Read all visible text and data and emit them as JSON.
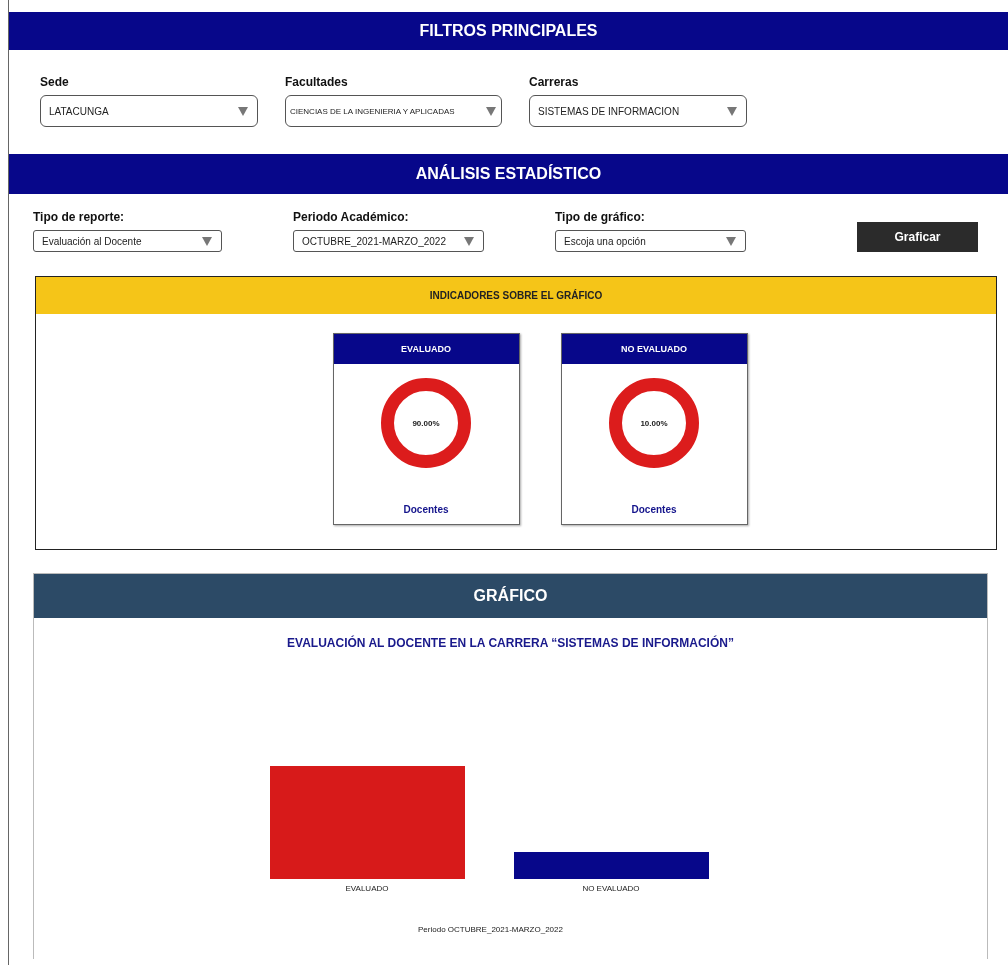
{
  "filters": {
    "title": "FILTROS PRINCIPALES",
    "selects": [
      {
        "label": "Sede",
        "value": "LATACUNGA"
      },
      {
        "label": "Facultades",
        "value": "CIENCIAS DE LA INGENIERIA Y APLICADAS"
      },
      {
        "label": "Carreras",
        "value": "SISTEMAS DE INFORMACION"
      }
    ]
  },
  "analysis": {
    "title": "ANÁLISIS ESTADÍSTICO",
    "selects": [
      {
        "label": "Tipo de reporte:",
        "value": "Evaluación al Docente"
      },
      {
        "label": "Periodo Académico:",
        "value": "OCTUBRE_2021-MARZO_2022"
      },
      {
        "label": "Tipo de gráfico:",
        "value": "Escoja una opción"
      }
    ],
    "button": "Graficar"
  },
  "indicators": {
    "title": "INDICADORES SOBRE EL GRÁFICO",
    "cards": [
      {
        "title": "EVALUADO",
        "value": "90.00%",
        "caption": "Docentes"
      },
      {
        "title": "NO EVALUADO",
        "value": "10.00%",
        "caption": "Docentes"
      }
    ]
  },
  "chart": {
    "title": "GRÁFICO",
    "subtitle": "EVALUACIÓN AL DOCENTE EN LA CARRERA “SISTEMAS DE INFORMACIÓN”",
    "bars": [
      {
        "label": "EVALUADO",
        "color": "#d71a1a"
      },
      {
        "label": "NO EVALUADO",
        "color": "#07078a"
      }
    ],
    "footer": "Periodo OCTUBRE_2021-MARZO_2022"
  }
}
